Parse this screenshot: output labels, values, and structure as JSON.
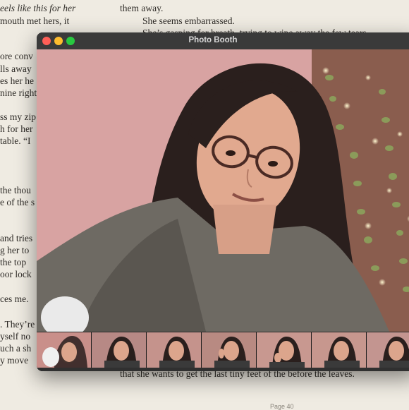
{
  "book": {
    "left_lines": [
      "eels like this for her",
      "mouth met hers, it",
      "",
      "ore conv",
      "lls away",
      "es her he",
      "nine right",
      "",
      "ss my zip",
      "h for her",
      " table. “I",
      "",
      " the thou",
      "e of the s",
      "",
      "and tries",
      "g her to",
      " the top",
      "oor lock",
      "",
      "ces me.",
      "",
      ". They’re",
      "yself no",
      "uch a sh",
      "y move"
    ],
    "right_lines": [
      "them away.",
      "She seems embarrassed.",
      "She’s gasping for breath, trying to wipe away the few tears"
    ],
    "bottom_line": "that she wants to get the last tiny feet of the before the leaves.",
    "page_number": "Page 40"
  },
  "window": {
    "title": "Photo Booth"
  },
  "thumbnails": [
    {
      "name": "thumbnail-1",
      "bg": "#c98f8a"
    },
    {
      "name": "thumbnail-2",
      "bg": "#b78985"
    },
    {
      "name": "thumbnail-3",
      "bg": "#c5938c"
    },
    {
      "name": "thumbnail-4",
      "bg": "#b88a82"
    },
    {
      "name": "thumbnail-5",
      "bg": "#c89890"
    },
    {
      "name": "thumbnail-6",
      "bg": "#c7978e"
    },
    {
      "name": "thumbnail-7",
      "bg": "#c39590"
    }
  ],
  "toolbar": {
    "modes": [
      {
        "name": "four-up-mode-button",
        "icon": "grid-icon",
        "active": false
      },
      {
        "name": "single-photo-mode-button",
        "icon": "portrait-icon",
        "active": true
      },
      {
        "name": "video-mode-button",
        "icon": "video-camera-icon",
        "active": false
      }
    ],
    "shutter_icon": "camera-icon",
    "colors": {
      "shutter": "#e83b33",
      "toolbar_bg": "#303030",
      "titlebar_bg": "#3a3a3a"
    }
  }
}
